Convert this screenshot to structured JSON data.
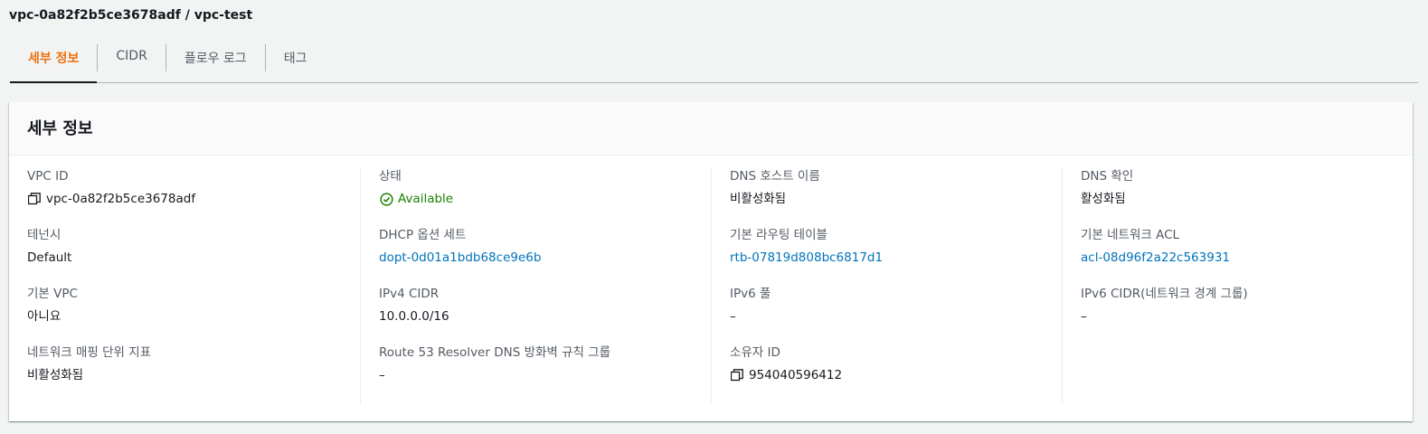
{
  "header": {
    "title": "vpc-0a82f2b5ce3678adf / vpc-test"
  },
  "tabs": [
    {
      "label": "세부 정보"
    },
    {
      "label": "CIDR"
    },
    {
      "label": "플로우 로그"
    },
    {
      "label": "태그"
    }
  ],
  "panel": {
    "title": "세부 정보"
  },
  "details": {
    "vpc_id": {
      "label": "VPC ID",
      "value": "vpc-0a82f2b5ce3678adf"
    },
    "tenancy": {
      "label": "테넌시",
      "value": "Default"
    },
    "default_vpc": {
      "label": "기본 VPC",
      "value": "아니요"
    },
    "network_mapping": {
      "label": "네트워크 매핑 단위 지표",
      "value": "비활성화됨"
    },
    "state": {
      "label": "상태",
      "value": "Available"
    },
    "dhcp": {
      "label": "DHCP 옵션 세트",
      "value": "dopt-0d01a1bdb68ce9e6b"
    },
    "ipv4_cidr": {
      "label": "IPv4 CIDR",
      "value": "10.0.0.0/16"
    },
    "route53": {
      "label": "Route 53 Resolver DNS 방화벽 규칙 그룹",
      "value": "–"
    },
    "dns_hostnames": {
      "label": "DNS 호스트 이름",
      "value": "비활성화됨"
    },
    "main_route_table": {
      "label": "기본 라우팅 테이블",
      "value": "rtb-07819d808bc6817d1"
    },
    "ipv6_pool": {
      "label": "IPv6 풀",
      "value": "–"
    },
    "owner_id": {
      "label": "소유자 ID",
      "value": "954040596412"
    },
    "dns_resolution": {
      "label": "DNS 확인",
      "value": "활성화됨"
    },
    "main_acl": {
      "label": "기본 네트워크 ACL",
      "value": "acl-08d96f2a22c563931"
    },
    "ipv6_cidr": {
      "label": "IPv6 CIDR(네트워크 경계 그룹)",
      "value": "–"
    }
  },
  "colors": {
    "accent": "#ec7211",
    "link": "#0073bb",
    "success": "#1d8102"
  },
  "icons": {
    "copy": "copy-icon",
    "status": "status-positive-icon"
  }
}
